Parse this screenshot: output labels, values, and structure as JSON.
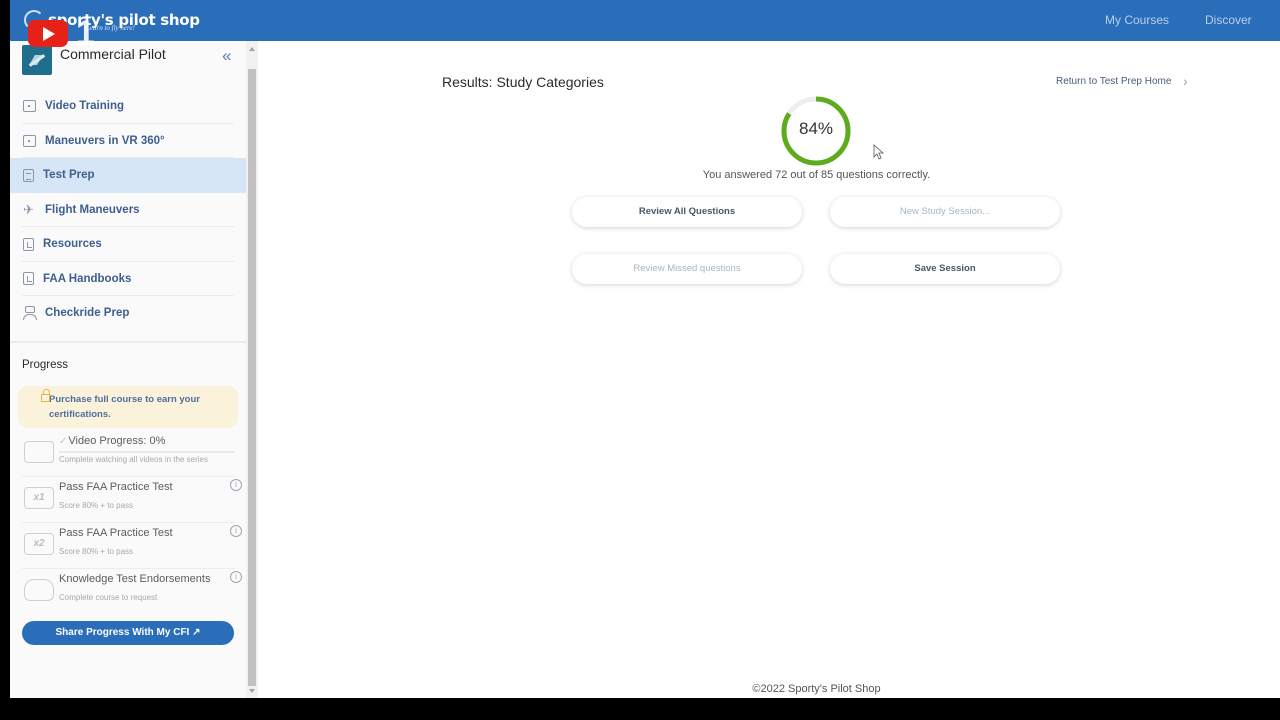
{
  "header": {
    "brand": "sporty's pilot shop",
    "tagline": "Learn to fly here!",
    "overlay_number": "1",
    "nav": [
      "My Courses",
      "Discover"
    ],
    "brand_color": "#2a6db8"
  },
  "sidebar": {
    "course_title": "Commercial Pilot",
    "collapse_icon": "«",
    "items": [
      {
        "label": "Video Training",
        "icon": "play-box-icon",
        "active": false
      },
      {
        "label": "Maneuvers in VR 360°",
        "icon": "play-box-icon",
        "active": false
      },
      {
        "label": "Test Prep",
        "icon": "document-icon",
        "active": true
      },
      {
        "label": "Flight Maneuvers",
        "icon": "airplane-icon",
        "active": false
      },
      {
        "label": "Resources",
        "icon": "pdf-icon",
        "active": false
      },
      {
        "label": "FAA Handbooks",
        "icon": "pdf-icon",
        "active": false
      },
      {
        "label": "Checkride Prep",
        "icon": "pilot-icon",
        "active": false
      }
    ],
    "progress": {
      "title": "Progress",
      "notice_line1": "Purchase full course to earn your",
      "notice_line2": "certifications.",
      "rows": [
        {
          "title": "Video Progress: 0%",
          "subtitle": "Complete watching all videos in the series",
          "icon": "video-progress-icon",
          "value": 0
        },
        {
          "title": "Pass FAA Practice Test",
          "subtitle": "Score 80% + to pass",
          "icon": "x1",
          "info": "i"
        },
        {
          "title": "Pass FAA Practice Test",
          "subtitle": "Score 80% + to pass",
          "icon": "x2",
          "info": "i"
        },
        {
          "title": "Knowledge Test Endorsements",
          "subtitle": "Complete course to request",
          "icon": "wings-badge-icon",
          "info": "i"
        }
      ],
      "share_button": "Share Progress With My CFI ↗"
    }
  },
  "main": {
    "title": "Results: Study Categories",
    "return_link": "Return to  Test Prep Home",
    "return_chevron": "›",
    "score_percent": 84,
    "score_label": "84%",
    "summary": "You answered 72 out of 85 questions correctly.",
    "correct": 72,
    "total": 85,
    "ring_color": "#5fab1f",
    "ring_track_color": "#eeeeee",
    "buttons": {
      "review_all": "Review All Questions",
      "new_session": "New Study Session...",
      "review_missed": "Review Missed questions",
      "save_session": "Save Session"
    }
  },
  "footer": {
    "copyright": "©2022 Sporty's Pilot Shop"
  }
}
